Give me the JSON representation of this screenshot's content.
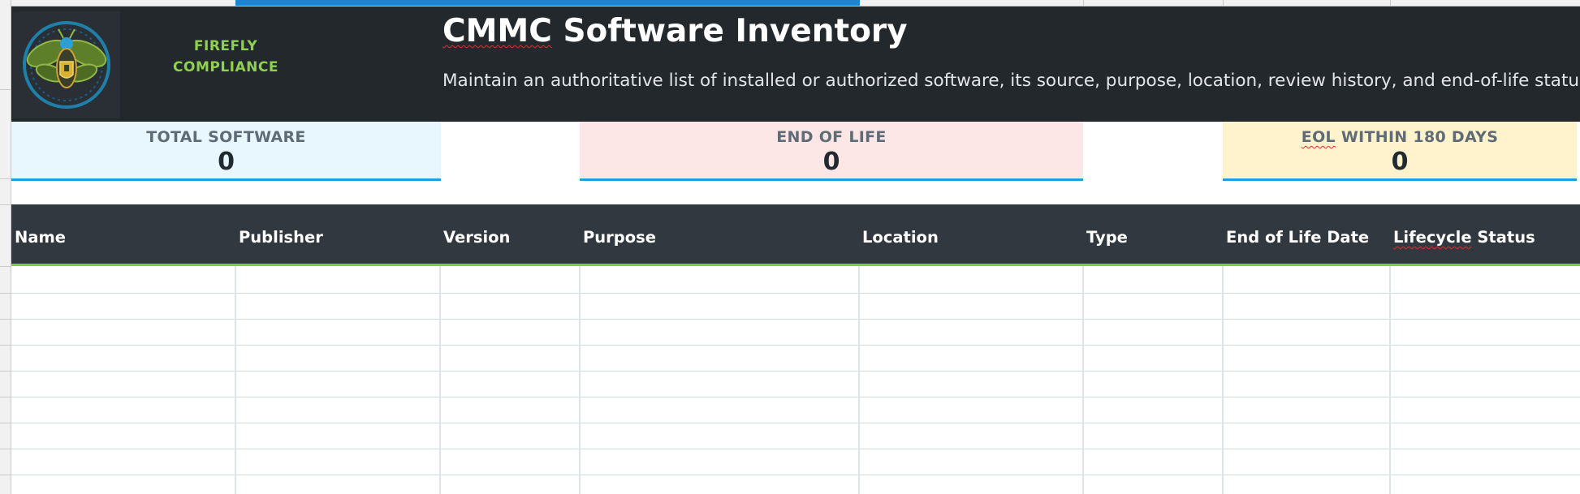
{
  "brand": {
    "line1": "FIREFLY",
    "line2": "COMPLIANCE"
  },
  "header": {
    "title_abbrev": "CMMC",
    "title_rest": " Software Inventory",
    "description": "Maintain an authoritative list of installed or authorized software, its source, purpose, location, review history, and end-of-life status."
  },
  "kpis": {
    "total": {
      "label": "TOTAL SOFTWARE",
      "value": "0"
    },
    "eol": {
      "label": "END OF LIFE",
      "value": "0"
    },
    "eol180": {
      "label_abbrev": "EOL",
      "label_rest": " WITHIN 180 DAYS",
      "value": "0"
    }
  },
  "table": {
    "columns": [
      "Name",
      "Publisher",
      "Version",
      "Purpose",
      "Location",
      "Type",
      "End of Life Date",
      "Lifecycle Status"
    ],
    "rows": []
  },
  "colors": {
    "banner": "#23282d",
    "brand_green": "#8fd14f",
    "header_row": "#32383f",
    "header_rule": "#7ecb3f",
    "kpi_rule": "#1f9fe0",
    "kpi_total_bg": "#e8f6fd",
    "kpi_eol_bg": "#fde6e6",
    "kpi_eol180_bg": "#fff3cd"
  }
}
